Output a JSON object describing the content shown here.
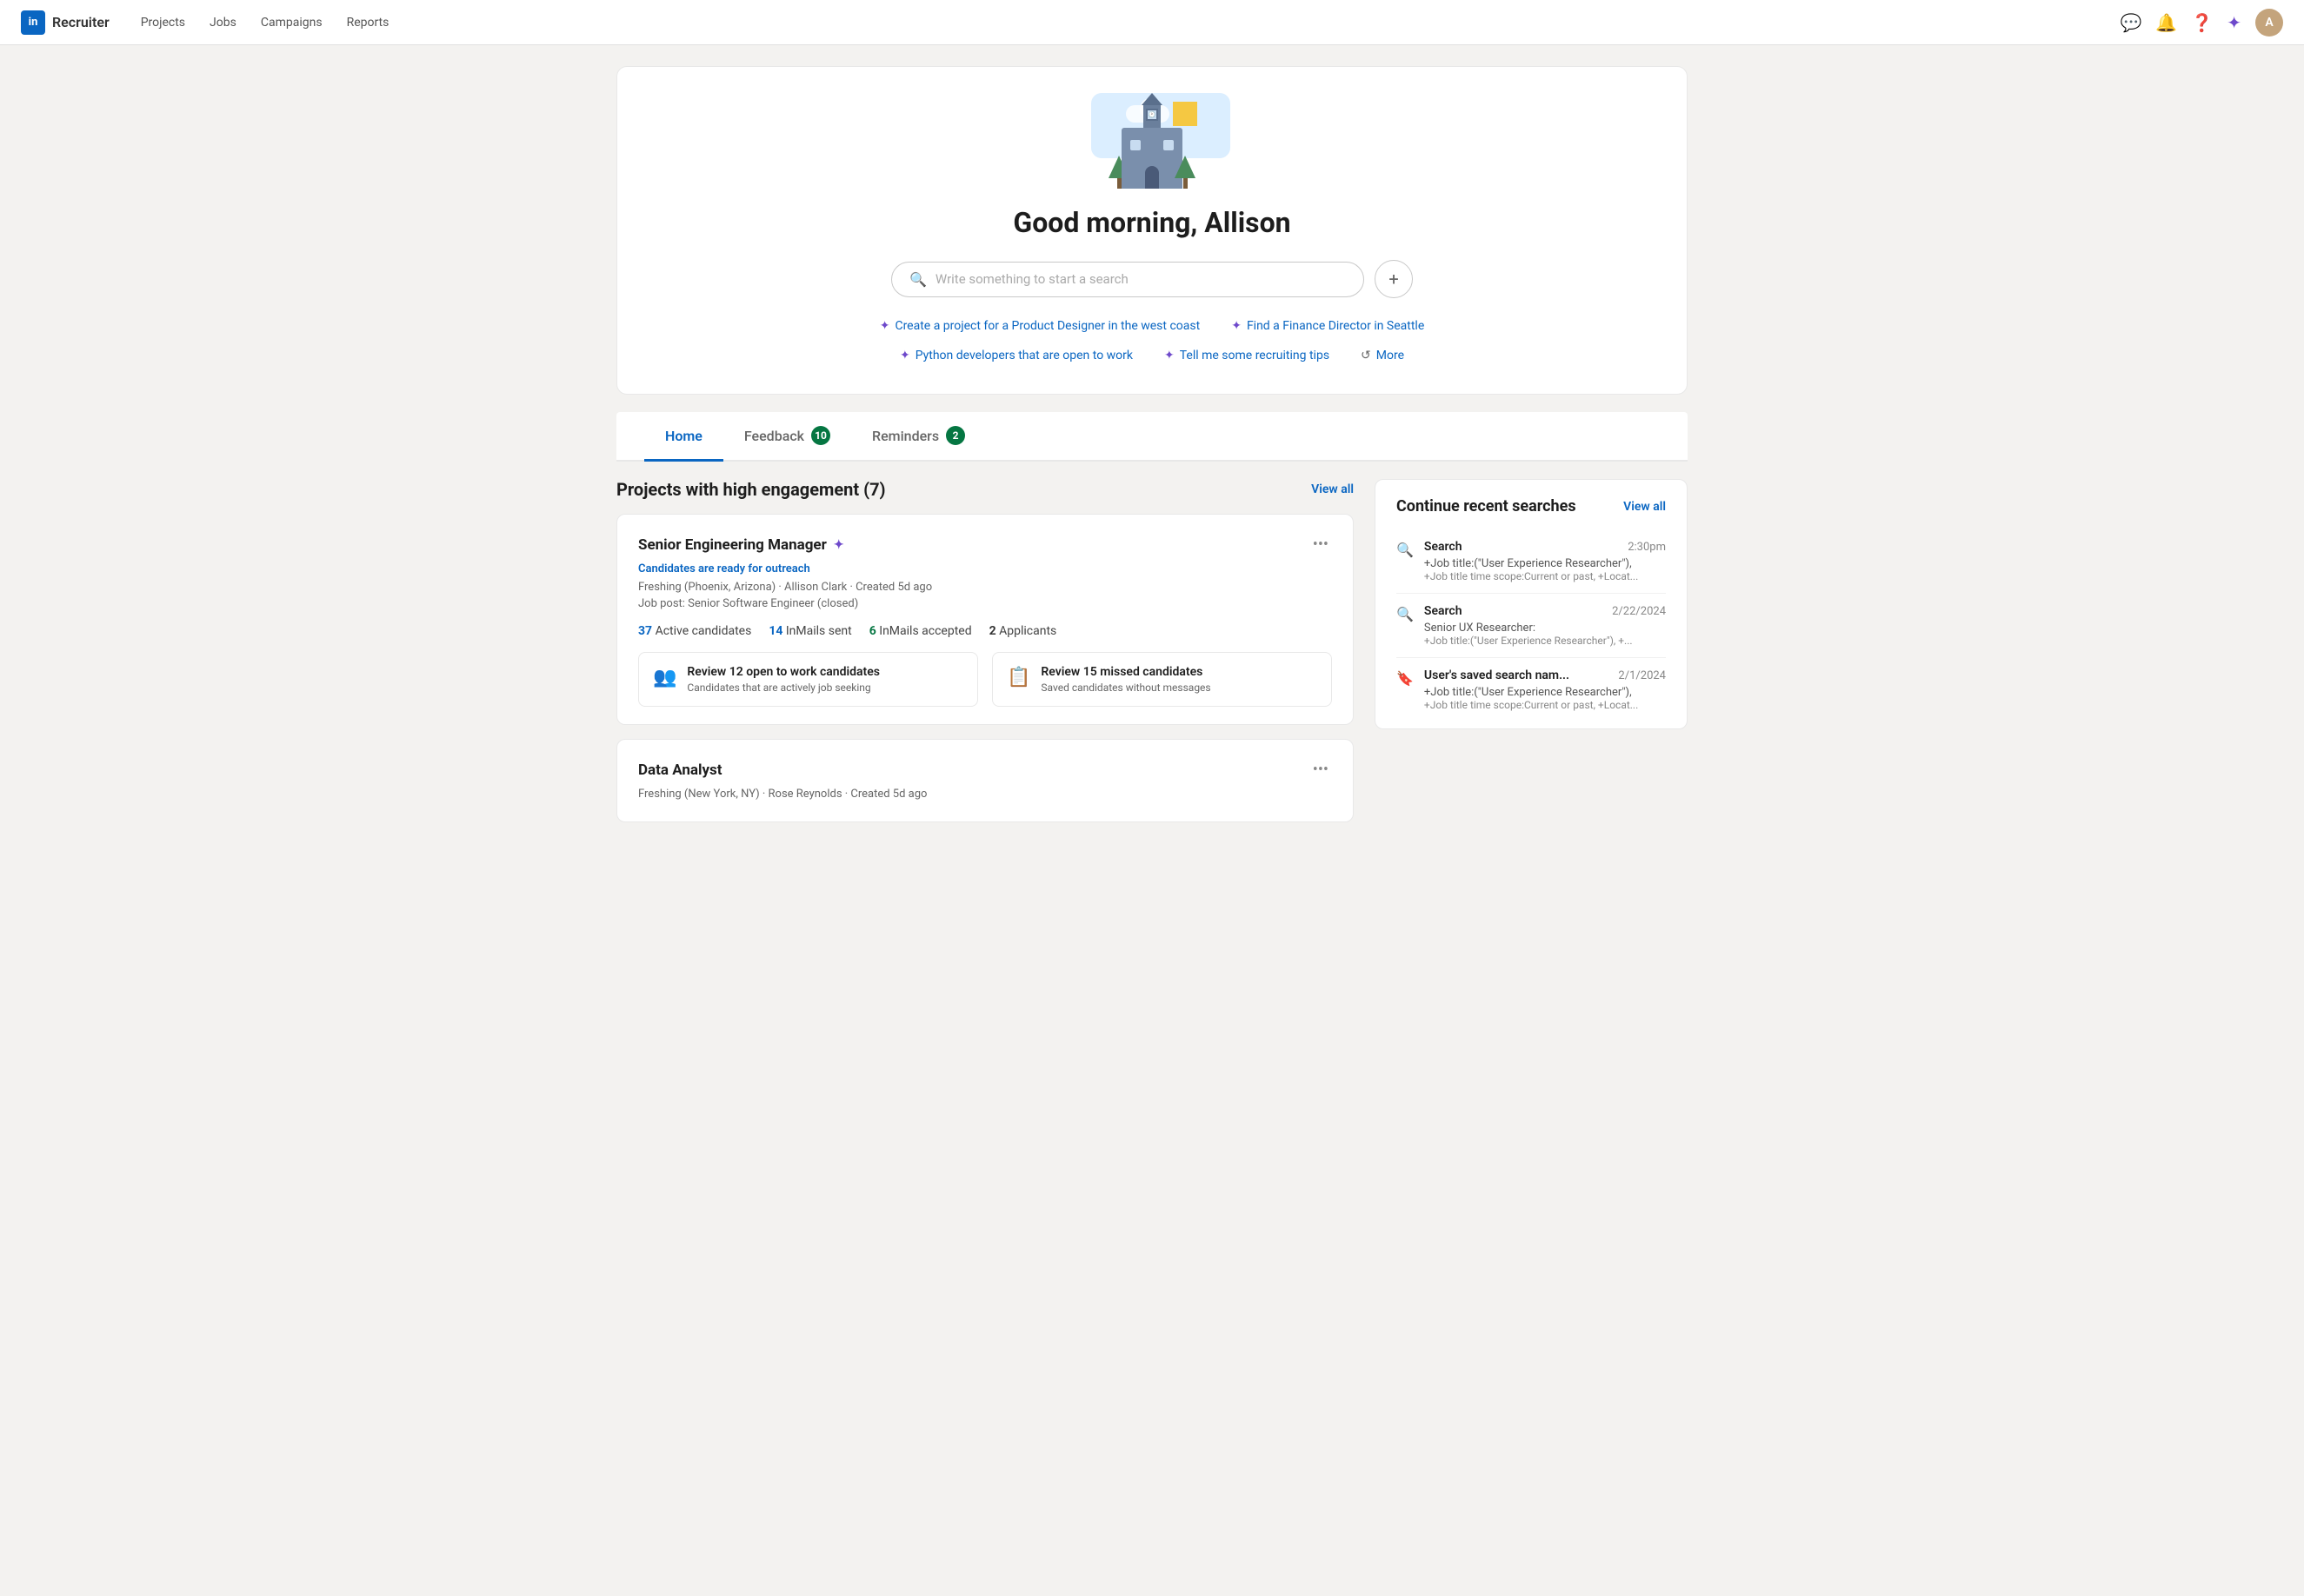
{
  "navbar": {
    "brand": "Recruiter",
    "linkedin_label": "in",
    "nav_items": [
      "Projects",
      "Jobs",
      "Campaigns",
      "Reports"
    ],
    "avatar_initials": "A"
  },
  "hero": {
    "greeting": "Good morning, Allison",
    "search_placeholder": "Write something to start a search",
    "suggestions": [
      {
        "id": "s1",
        "text": "Create a project for a Product Designer in the west coast",
        "type": "star"
      },
      {
        "id": "s2",
        "text": "Find a Finance Director in Seattle",
        "type": "star"
      },
      {
        "id": "s3",
        "text": "Python developers that are open to work",
        "type": "star"
      },
      {
        "id": "s4",
        "text": "Tell me some recruiting tips",
        "type": "star"
      },
      {
        "id": "s5",
        "text": "More",
        "type": "refresh"
      }
    ]
  },
  "tabs": {
    "items": [
      {
        "id": "home",
        "label": "Home",
        "badge": null,
        "active": true
      },
      {
        "id": "feedback",
        "label": "Feedback",
        "badge": "10",
        "active": false
      },
      {
        "id": "reminders",
        "label": "Reminders",
        "badge": "2",
        "active": false
      }
    ]
  },
  "projects_section": {
    "title": "Projects with high engagement (7)",
    "view_all_label": "View all",
    "cards": [
      {
        "id": "p1",
        "name": "Senior Engineering Manager",
        "has_spark": true,
        "status": "Candidates are ready for outreach",
        "meta1": "Freshing (Phoenix, Arizona) · Allison Clark · Created 5d ago",
        "meta2": "Job post: Senior Software Engineer (closed)",
        "stats": [
          {
            "num": "37",
            "label": "Active candidates",
            "color": "blue"
          },
          {
            "num": "14",
            "label": "InMails sent",
            "color": "blue"
          },
          {
            "num": "6",
            "label": "InMails accepted",
            "color": "green"
          },
          {
            "num": "2",
            "label": "Applicants",
            "color": "gray"
          }
        ],
        "actions": [
          {
            "title": "Review 12 open to work candidates",
            "desc": "Candidates that are actively job seeking",
            "icon": "👥"
          },
          {
            "title": "Review 15 missed candidates",
            "desc": "Saved candidates without messages",
            "icon": "📋"
          }
        ]
      },
      {
        "id": "p2",
        "name": "Data Analyst",
        "has_spark": false,
        "status": "",
        "meta1": "Freshing (New York, NY) · Rose Reynolds · Created 5d ago",
        "meta2": "",
        "stats": [],
        "actions": []
      }
    ]
  },
  "recent_searches": {
    "title": "Continue recent searches",
    "view_all_label": "View all",
    "items": [
      {
        "id": "r1",
        "type": "search",
        "label": "Search",
        "date": "2:30pm",
        "desc": "+Job title:(\"User Experience Researcher\"),",
        "subdesc": "+Job title time scope:Current or past, +Locat..."
      },
      {
        "id": "r2",
        "type": "search",
        "label": "Search",
        "date": "2/22/2024",
        "desc": "Senior UX Researcher:",
        "subdesc": "+Job title:(\"User Experience Researcher\"), +..."
      },
      {
        "id": "r3",
        "type": "bookmark",
        "label": "User's saved search nam...",
        "date": "2/1/2024",
        "desc": "+Job title:(\"User Experience Researcher\"),",
        "subdesc": "+Job title time scope:Current or past, +Locat..."
      }
    ]
  }
}
